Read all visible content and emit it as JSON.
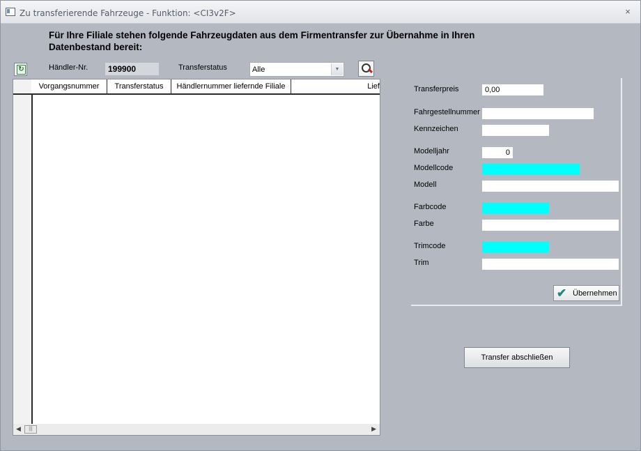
{
  "window": {
    "title": "Zu transferierende Fahrzeuge - Funktion: <CI3v2F>",
    "close_symbol": "×"
  },
  "headline": "Für Ihre Filiale stehen folgende Fahrzeugdaten aus dem Firmentransfer zur Übernahme in Ihren Datenbestand bereit:",
  "filter": {
    "dealer_label": "Händler-Nr.",
    "dealer_value": "199900",
    "status_label": "Transferstatus",
    "status_value": "Alle"
  },
  "grid": {
    "columns": [
      "Vorgangsnummer",
      "Transferstatus",
      "Händlernummer liefernde Filiale",
      "Lief"
    ],
    "rows": []
  },
  "details": {
    "transferpreis": {
      "label": "Transferpreis",
      "value": "0,00"
    },
    "fahrgestellnummer": {
      "label": "Fahrgestellnummer",
      "value": ""
    },
    "kennzeichen": {
      "label": "Kennzeichen",
      "value": ""
    },
    "modelljahr": {
      "label": "Modelljahr",
      "value": "0"
    },
    "modellcode": {
      "label": "Modellcode",
      "value": ""
    },
    "modell": {
      "label": "Modell",
      "value": ""
    },
    "farbcode": {
      "label": "Farbcode",
      "value": ""
    },
    "farbe": {
      "label": "Farbe",
      "value": ""
    },
    "trimcode": {
      "label": "Trimcode",
      "value": ""
    },
    "trim": {
      "label": "Trim",
      "value": ""
    }
  },
  "buttons": {
    "uebernehmen": "Übernehmen",
    "transfer_abschliessen": "Transfer abschließen"
  },
  "colors": {
    "highlight_field": "#00ffff",
    "window_bg": "#b4b9c1"
  },
  "icons": [
    "window-icon",
    "refresh-icon",
    "search-icon",
    "check-icon",
    "close-icon"
  ]
}
